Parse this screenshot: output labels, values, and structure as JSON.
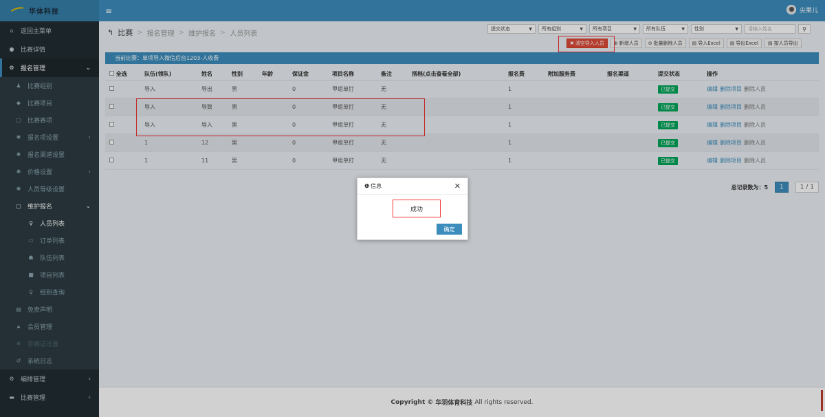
{
  "brand": {
    "name": "华体科技"
  },
  "user": {
    "name": "尖果儿"
  },
  "sidebar": {
    "items": [
      {
        "label": "返回主菜单",
        "icon": "home-icon"
      },
      {
        "label": "比赛详情",
        "icon": "info-icon"
      },
      {
        "label": "报名管理",
        "icon": "cogs-icon"
      },
      {
        "label": "比赛组别",
        "icon": "user-icon"
      },
      {
        "label": "比赛项目",
        "icon": "sport-icon"
      },
      {
        "label": "比赛赛项",
        "icon": "square-icon"
      },
      {
        "label": "报名项设置",
        "icon": "gear-icon"
      },
      {
        "label": "报名渠道设置",
        "icon": "gear-icon"
      },
      {
        "label": "价格设置",
        "icon": "gear-icon"
      },
      {
        "label": "人员等级设置",
        "icon": "gear-icon"
      },
      {
        "label": "维护报名",
        "icon": "square-icon"
      },
      {
        "label": "人员列表",
        "icon": "person-icon"
      },
      {
        "label": "订单列表",
        "icon": "card-icon"
      },
      {
        "label": "队伍列表",
        "icon": "group-icon"
      },
      {
        "label": "项目列表",
        "icon": "square-icon"
      },
      {
        "label": "组别查询",
        "icon": "person-icon"
      },
      {
        "label": "免责声明",
        "icon": "keyboard-icon"
      },
      {
        "label": "会员管理",
        "icon": "lock-icon"
      },
      {
        "label": "参赛证设置",
        "icon": "gear-icon"
      },
      {
        "label": "系统日志",
        "icon": "history-icon"
      },
      {
        "label": "编排管理",
        "icon": "gear-icon"
      },
      {
        "label": "比赛管理",
        "icon": "folder-icon"
      }
    ]
  },
  "breadcrumb": {
    "back": "↰",
    "items": [
      "比赛",
      "报名管理",
      "维护报名",
      "人员列表"
    ]
  },
  "filters": {
    "status": "提交状态",
    "group": "所有组别",
    "project": "所有项目",
    "team": "所有队伍",
    "gender": "性别",
    "name_placeholder": "请输入姓名"
  },
  "actions": {
    "clear_import": "清空导入人员",
    "add": "新增人员",
    "batch_delete": "批量删除人员",
    "import_excel": "导入Excel",
    "export_excel": "导出Excel",
    "export_by_person": "按人员导出"
  },
  "info_bar": "当前比赛：单项导入微信后台1203-人收费",
  "table": {
    "headers": [
      "全选",
      "队伍(领队)",
      "姓名",
      "性别",
      "年龄",
      "保证金",
      "项目名称",
      "备注",
      "搭档(点击查看全部)",
      "报名费",
      "附加服务费",
      "报名渠道",
      "提交状态",
      "操作"
    ],
    "rows": [
      {
        "team": "导入",
        "name": "导出",
        "gender": "男",
        "age": "",
        "deposit": "0",
        "project": "甲组单打",
        "note": "无",
        "partner": "",
        "fee": "1",
        "extra": "",
        "channel": "",
        "status": "已提交"
      },
      {
        "team": "导入",
        "name": "导致",
        "gender": "男",
        "age": "",
        "deposit": "0",
        "project": "甲组单打",
        "note": "无",
        "partner": "",
        "fee": "1",
        "extra": "",
        "channel": "",
        "status": "已提交"
      },
      {
        "team": "导入",
        "name": "导入",
        "gender": "男",
        "age": "",
        "deposit": "0",
        "project": "甲组单打",
        "note": "无",
        "partner": "",
        "fee": "1",
        "extra": "",
        "channel": "",
        "status": "已提交"
      },
      {
        "team": "1",
        "name": "12",
        "gender": "男",
        "age": "",
        "deposit": "0",
        "project": "甲组单打",
        "note": "无",
        "partner": "",
        "fee": "1",
        "extra": "",
        "channel": "",
        "status": "已提交"
      },
      {
        "team": "1",
        "name": "11",
        "gender": "男",
        "age": "",
        "deposit": "0",
        "project": "甲组单打",
        "note": "无",
        "partner": "",
        "fee": "1",
        "extra": "",
        "channel": "",
        "status": "已提交"
      }
    ],
    "row_actions": {
      "edit": "编辑",
      "delete_project": "删除项目",
      "delete_person": "删除人员"
    }
  },
  "pagination": {
    "total_label": "总记录数为：5",
    "current": "1",
    "pages": "1 / 1"
  },
  "dialog": {
    "title": "信息",
    "message": "成功",
    "ok": "确定"
  },
  "footer": {
    "copyright": "Copyright ©",
    "company": "华羽体育科技",
    "rights": "All rights reserved."
  },
  "colors": {
    "header": "#3c8dbc",
    "sidebar": "#222d32",
    "danger": "#dd4b39",
    "success": "#00a65a"
  }
}
